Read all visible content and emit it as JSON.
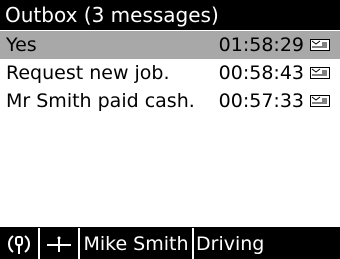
{
  "title": "Outbox (3 messages)",
  "messages": [
    {
      "subject": "Yes",
      "time": "01:58:29",
      "selected": true
    },
    {
      "subject": "Request new job.",
      "time": "00:58:43",
      "selected": false
    },
    {
      "subject": "Mr Smith paid cash.",
      "time": "00:57:33",
      "selected": false
    }
  ],
  "status": {
    "icon1": "gps-signal-icon",
    "icon2": "antenna-icon",
    "driver": "Mike Smith",
    "state": "Driving"
  },
  "colors": {
    "bar_background": "#000000",
    "selected_row": "#a8a8a8"
  }
}
